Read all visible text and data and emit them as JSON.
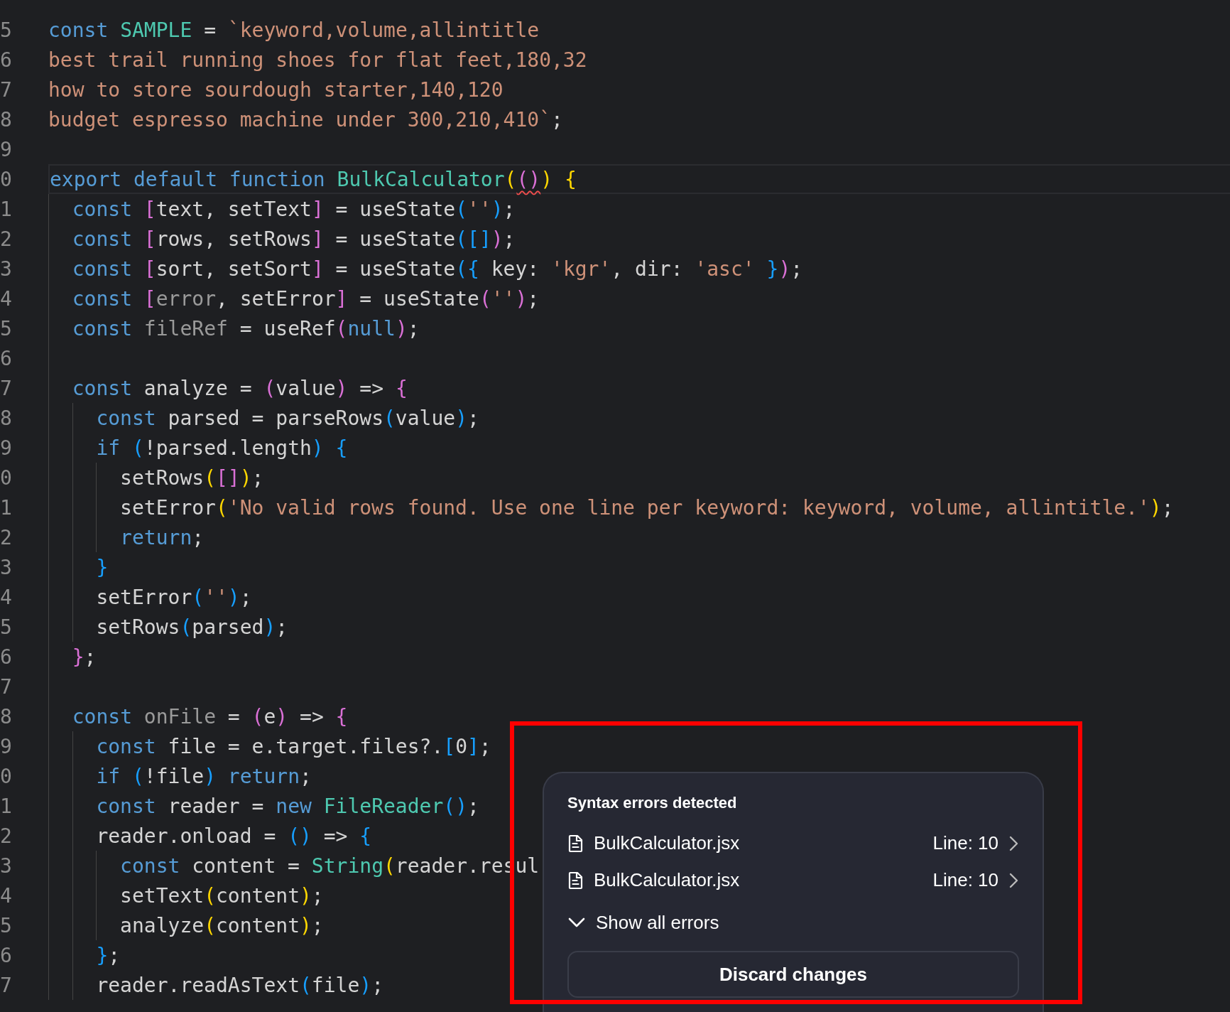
{
  "editor": {
    "lines": [
      {
        "number": "5",
        "current": false,
        "tokens": [
          {
            "text": "const ",
            "kind": "keyword"
          },
          {
            "text": "SAMPLE",
            "kind": "class"
          },
          {
            "text": " = ",
            "kind": "plain"
          },
          {
            "text": "`keyword,volume,allintitle",
            "kind": "string"
          }
        ]
      },
      {
        "number": "6",
        "current": false,
        "tokens": [
          {
            "text": "best trail running shoes for flat feet,180,32",
            "kind": "string"
          }
        ]
      },
      {
        "number": "7",
        "current": false,
        "tokens": [
          {
            "text": "how to store sourdough starter,140,120",
            "kind": "string"
          }
        ]
      },
      {
        "number": "8",
        "current": false,
        "tokens": [
          {
            "text": "budget espresso machine under 300,210,410`",
            "kind": "string"
          },
          {
            "text": ";",
            "kind": "plain"
          }
        ]
      },
      {
        "number": "9",
        "current": false
      },
      {
        "number": "0",
        "current": true,
        "tokens": [
          {
            "text": "export default function ",
            "kind": "keyword"
          },
          {
            "text": "BulkCalculator",
            "kind": "class"
          },
          {
            "text": "(",
            "kind": "bracket1"
          },
          {
            "text": "()",
            "kind": "bracket2",
            "error": true
          },
          {
            "text": ") ",
            "kind": "bracket1"
          },
          {
            "text": "{",
            "kind": "bracket1"
          }
        ]
      },
      {
        "number": "1",
        "current": false,
        "tokens": [
          {
            "text": "  const ",
            "kind": "keyword"
          },
          {
            "text": "[",
            "kind": "bracket2"
          },
          {
            "text": "text, setText",
            "kind": "plain"
          },
          {
            "text": "]",
            "kind": "bracket2"
          },
          {
            "text": " = useState",
            "kind": "plain"
          },
          {
            "text": "(",
            "kind": "bracket3"
          },
          {
            "text": "''",
            "kind": "string"
          },
          {
            "text": ")",
            "kind": "bracket3"
          },
          {
            "text": ";",
            "kind": "plain"
          }
        ]
      },
      {
        "number": "2",
        "current": false,
        "tokens": [
          {
            "text": "  const ",
            "kind": "keyword"
          },
          {
            "text": "[",
            "kind": "bracket2"
          },
          {
            "text": "rows, setRows",
            "kind": "plain"
          },
          {
            "text": "]",
            "kind": "bracket2"
          },
          {
            "text": " = useState",
            "kind": "plain"
          },
          {
            "text": "(",
            "kind": "bracket3"
          },
          {
            "text": "[]",
            "kind": "bracket3"
          },
          {
            "text": ")",
            "kind": "bracket2"
          },
          {
            "text": ";",
            "kind": "plain"
          }
        ]
      },
      {
        "number": "3",
        "current": false,
        "tokens": [
          {
            "text": "  const ",
            "kind": "keyword"
          },
          {
            "text": "[",
            "kind": "bracket2"
          },
          {
            "text": "sort, setSort",
            "kind": "plain"
          },
          {
            "text": "]",
            "kind": "bracket2"
          },
          {
            "text": " = useState",
            "kind": "plain"
          },
          {
            "text": "({",
            "kind": "bracket3"
          },
          {
            "text": " key: ",
            "kind": "plain"
          },
          {
            "text": "'kgr'",
            "kind": "string"
          },
          {
            "text": ", dir: ",
            "kind": "plain"
          },
          {
            "text": "'asc' ",
            "kind": "string"
          },
          {
            "text": "}",
            "kind": "bracket3"
          },
          {
            "text": ")",
            "kind": "bracket2"
          },
          {
            "text": ";",
            "kind": "plain"
          }
        ]
      },
      {
        "number": "4",
        "current": false,
        "tokens": [
          {
            "text": "  const ",
            "kind": "keyword"
          },
          {
            "text": "[",
            "kind": "bracket2"
          },
          {
            "text": "error",
            "kind": "unused"
          },
          {
            "text": ", setError",
            "kind": "plain"
          },
          {
            "text": "]",
            "kind": "bracket2"
          },
          {
            "text": " = useState",
            "kind": "plain"
          },
          {
            "text": "(",
            "kind": "bracket2"
          },
          {
            "text": "''",
            "kind": "string"
          },
          {
            "text": ")",
            "kind": "bracket2"
          },
          {
            "text": ";",
            "kind": "plain"
          }
        ]
      },
      {
        "number": "5",
        "current": false,
        "tokens": [
          {
            "text": "  const ",
            "kind": "keyword"
          },
          {
            "text": "fileRef",
            "kind": "unused"
          },
          {
            "text": " = useRef",
            "kind": "plain"
          },
          {
            "text": "(",
            "kind": "bracket2"
          },
          {
            "text": "null",
            "kind": "keyword"
          },
          {
            "text": ")",
            "kind": "bracket2"
          },
          {
            "text": ";",
            "kind": "plain"
          }
        ]
      },
      {
        "number": "6",
        "current": false
      },
      {
        "number": "7",
        "current": false,
        "tokens": [
          {
            "text": "  const",
            "kind": "keyword"
          },
          {
            "text": " analyze = ",
            "kind": "plain"
          },
          {
            "text": "(",
            "kind": "bracket2"
          },
          {
            "text": "value",
            "kind": "plain"
          },
          {
            "text": ")",
            "kind": "bracket2"
          },
          {
            "text": " => ",
            "kind": "plain"
          },
          {
            "text": "{",
            "kind": "bracket2"
          }
        ]
      },
      {
        "number": "8",
        "current": false,
        "tokens": [
          {
            "text": "    const",
            "kind": "keyword"
          },
          {
            "text": " parsed = parseRows",
            "kind": "plain"
          },
          {
            "text": "(",
            "kind": "bracket3"
          },
          {
            "text": "value",
            "kind": "plain"
          },
          {
            "text": ")",
            "kind": "bracket3"
          },
          {
            "text": ";",
            "kind": "plain"
          }
        ]
      },
      {
        "number": "9",
        "current": false,
        "tokens": [
          {
            "text": "    if ",
            "kind": "keyword"
          },
          {
            "text": "(",
            "kind": "bracket3"
          },
          {
            "text": "!parsed.length",
            "kind": "plain"
          },
          {
            "text": ") ",
            "kind": "bracket3"
          },
          {
            "text": "{",
            "kind": "bracket3"
          }
        ]
      },
      {
        "number": "0",
        "current": false,
        "tokens": [
          {
            "text": "      setRows",
            "kind": "plain"
          },
          {
            "text": "(",
            "kind": "bracket1"
          },
          {
            "text": "[]",
            "kind": "bracket2"
          },
          {
            "text": ")",
            "kind": "bracket1"
          },
          {
            "text": ";",
            "kind": "plain"
          }
        ]
      },
      {
        "number": "1",
        "current": false,
        "tokens": [
          {
            "text": "      setError",
            "kind": "plain"
          },
          {
            "text": "(",
            "kind": "bracket1"
          },
          {
            "text": "'No valid rows found. Use one line per keyword: keyword, volume, allintitle.'",
            "kind": "string"
          },
          {
            "text": ")",
            "kind": "bracket1"
          },
          {
            "text": ";",
            "kind": "plain"
          }
        ]
      },
      {
        "number": "2",
        "current": false,
        "tokens": [
          {
            "text": "      return",
            "kind": "keyword"
          },
          {
            "text": ";",
            "kind": "plain"
          }
        ]
      },
      {
        "number": "3",
        "current": false,
        "tokens": [
          {
            "text": "    }",
            "kind": "bracket3"
          }
        ]
      },
      {
        "number": "4",
        "current": false,
        "tokens": [
          {
            "text": "    setError",
            "kind": "plain"
          },
          {
            "text": "(",
            "kind": "bracket3"
          },
          {
            "text": "''",
            "kind": "string"
          },
          {
            "text": ")",
            "kind": "bracket3"
          },
          {
            "text": ";",
            "kind": "plain"
          }
        ]
      },
      {
        "number": "5",
        "current": false,
        "tokens": [
          {
            "text": "    setRows",
            "kind": "plain"
          },
          {
            "text": "(",
            "kind": "bracket3"
          },
          {
            "text": "parsed",
            "kind": "plain"
          },
          {
            "text": ")",
            "kind": "bracket3"
          },
          {
            "text": ";",
            "kind": "plain"
          }
        ]
      },
      {
        "number": "6",
        "current": false,
        "tokens": [
          {
            "text": "  }",
            "kind": "bracket2"
          },
          {
            "text": ";",
            "kind": "plain"
          }
        ]
      },
      {
        "number": "7",
        "current": false
      },
      {
        "number": "8",
        "current": false,
        "tokens": [
          {
            "text": "  const ",
            "kind": "keyword"
          },
          {
            "text": "onFile",
            "kind": "unused"
          },
          {
            "text": " = ",
            "kind": "plain"
          },
          {
            "text": "(",
            "kind": "bracket2"
          },
          {
            "text": "e",
            "kind": "plain"
          },
          {
            "text": ")",
            "kind": "bracket2"
          },
          {
            "text": " => ",
            "kind": "plain"
          },
          {
            "text": "{",
            "kind": "bracket2"
          }
        ]
      },
      {
        "number": "9",
        "current": false,
        "tokens": [
          {
            "text": "    const",
            "kind": "keyword"
          },
          {
            "text": " file = e.target.files?.",
            "kind": "plain"
          },
          {
            "text": "[",
            "kind": "bracket3"
          },
          {
            "text": "0",
            "kind": "plain"
          },
          {
            "text": "]",
            "kind": "bracket3"
          },
          {
            "text": ";",
            "kind": "plain"
          }
        ]
      },
      {
        "number": "0",
        "current": false,
        "tokens": [
          {
            "text": "    if ",
            "kind": "keyword"
          },
          {
            "text": "(",
            "kind": "bracket3"
          },
          {
            "text": "!file",
            "kind": "plain"
          },
          {
            "text": ") ",
            "kind": "bracket3"
          },
          {
            "text": "return",
            "kind": "keyword"
          },
          {
            "text": ";",
            "kind": "plain"
          }
        ]
      },
      {
        "number": "1",
        "current": false,
        "tokens": [
          {
            "text": "    const",
            "kind": "keyword"
          },
          {
            "text": " reader = ",
            "kind": "plain"
          },
          {
            "text": "new ",
            "kind": "keyword"
          },
          {
            "text": "FileReader",
            "kind": "class"
          },
          {
            "text": "()",
            "kind": "bracket3"
          },
          {
            "text": ";",
            "kind": "plain"
          }
        ]
      },
      {
        "number": "2",
        "current": false,
        "tokens": [
          {
            "text": "    reader.onload = ",
            "kind": "plain"
          },
          {
            "text": "()",
            "kind": "bracket3"
          },
          {
            "text": " => ",
            "kind": "plain"
          },
          {
            "text": "{",
            "kind": "bracket3"
          }
        ]
      },
      {
        "number": "3",
        "current": false,
        "tokens": [
          {
            "text": "      const",
            "kind": "keyword"
          },
          {
            "text": " content = ",
            "kind": "plain"
          },
          {
            "text": "String",
            "kind": "class"
          },
          {
            "text": "(",
            "kind": "bracket1"
          },
          {
            "text": "reader.resul",
            "kind": "plain"
          }
        ]
      },
      {
        "number": "4",
        "current": false,
        "tokens": [
          {
            "text": "      setText",
            "kind": "plain"
          },
          {
            "text": "(",
            "kind": "bracket1"
          },
          {
            "text": "content",
            "kind": "plain"
          },
          {
            "text": ")",
            "kind": "bracket1"
          },
          {
            "text": ";",
            "kind": "plain"
          }
        ]
      },
      {
        "number": "5",
        "current": false,
        "tokens": [
          {
            "text": "      analyze",
            "kind": "plain"
          },
          {
            "text": "(",
            "kind": "bracket1"
          },
          {
            "text": "content",
            "kind": "plain"
          },
          {
            "text": ")",
            "kind": "bracket1"
          },
          {
            "text": ";",
            "kind": "plain"
          }
        ]
      },
      {
        "number": "6",
        "current": false,
        "tokens": [
          {
            "text": "    }",
            "kind": "bracket3"
          },
          {
            "text": ";",
            "kind": "plain"
          }
        ]
      },
      {
        "number": "7",
        "current": false,
        "tokens": [
          {
            "text": "    reader.readAsText",
            "kind": "plain"
          },
          {
            "text": "(",
            "kind": "bracket3"
          },
          {
            "text": "file",
            "kind": "plain"
          },
          {
            "text": ")",
            "kind": "bracket3"
          },
          {
            "text": ";",
            "kind": "plain"
          }
        ]
      }
    ]
  },
  "error_popup": {
    "title": "Syntax errors detected",
    "errors": [
      {
        "file": "BulkCalculator.jsx",
        "line": "Line: 10"
      },
      {
        "file": "BulkCalculator.jsx",
        "line": "Line: 10"
      }
    ],
    "toggle": {
      "label": "Show all errors",
      "expanded": false
    },
    "button": "Discard changes",
    "annotation_frame": true
  }
}
